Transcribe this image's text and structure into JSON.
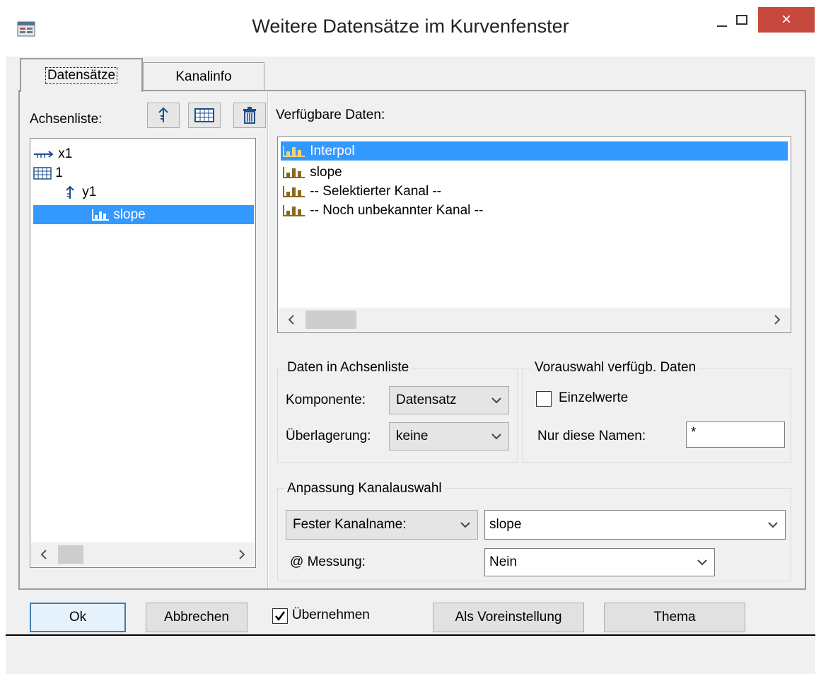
{
  "window": {
    "title": "Weitere Datensätze im Kurvenfenster",
    "close_glyph": "×"
  },
  "tabs": [
    {
      "label": "Datensätze",
      "active": true
    },
    {
      "label": "Kanalinfo",
      "active": false
    }
  ],
  "axis_list": {
    "label": "Achsenliste:",
    "items": [
      {
        "icon": "x-axis-icon",
        "label": "x1"
      },
      {
        "icon": "grid-icon",
        "label": "1"
      },
      {
        "icon": "y-axis-icon",
        "label": "y1"
      },
      {
        "icon": "dataset-icon",
        "label": "slope",
        "selected": true
      }
    ]
  },
  "available_data": {
    "label": "Verfügbare Daten:",
    "items": [
      {
        "label": "Interpol",
        "selected": true
      },
      {
        "label": "slope"
      },
      {
        "label": "-- Selektierter Kanal --"
      },
      {
        "label": "-- Noch unbekannter Kanal --"
      }
    ]
  },
  "group_data_in_axis_list": {
    "title": "Daten in Achsenliste",
    "component_label": "Komponente:",
    "component_value": "Datensatz",
    "overlay_label": "Überlagerung:",
    "overlay_value": "keine"
  },
  "group_preselection": {
    "title": "Vorauswahl verfügb. Daten",
    "single_values_label": "Einzelwerte",
    "single_values_checked": false,
    "names_label": "Nur diese Namen:",
    "names_value": "*"
  },
  "group_channel_adjust": {
    "title": "Anpassung Kanalauswahl",
    "mode_value": "Fester Kanalname:",
    "channel_value": "slope",
    "measurement_label": "@ Messung:",
    "measurement_value": "Nein"
  },
  "buttons": {
    "ok": "Ok",
    "cancel": "Abbrechen",
    "apply_label": "Übernehmen",
    "apply_checked": true,
    "preset": "Als Voreinstellung",
    "theme": "Thema"
  },
  "colors": {
    "selection": "#3399ff",
    "close": "#c7483d",
    "default_border": "#3c7fb1"
  }
}
